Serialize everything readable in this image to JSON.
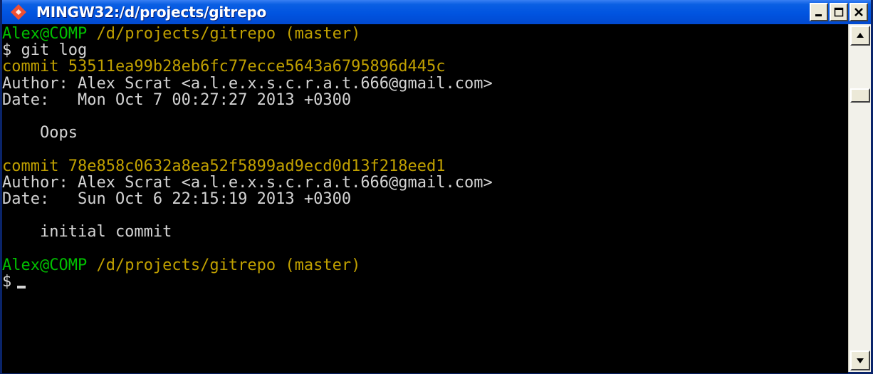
{
  "window": {
    "title": "MINGW32:/d/projects/gitrepo",
    "buttons": {
      "minimize": "minimize",
      "maximize": "maximize",
      "close": "close"
    }
  },
  "colors": {
    "prompt_user": "#00c000",
    "path": "#c0a000",
    "commit_hash": "#c0a000",
    "text": "#d4d4d4",
    "background": "#000000",
    "titlebar": "#0154e0"
  },
  "terminal": {
    "prompt1_user": "Alex@COMP",
    "prompt1_path": " /d/projects/gitrepo (master)",
    "command": "$ git log",
    "commit1": "commit 53511ea99b28eb6fc77ecce5643a6795896d445c",
    "author1": "Author: Alex Scrat <a.l.e.x.s.c.r.a.t.666@gmail.com>",
    "date1": "Date:   Mon Oct 7 00:27:27 2013 +0300",
    "message1": "    Oops",
    "commit2": "commit 78e858c0632a8ea52f5899ad9ecd0d13f218eed1",
    "author2": "Author: Alex Scrat <a.l.e.x.s.c.r.a.t.666@gmail.com>",
    "date2": "Date:   Sun Oct 6 22:15:19 2013 +0300",
    "message2": "    initial commit",
    "prompt2_user": "Alex@COMP",
    "prompt2_path": " /d/projects/gitrepo (master)",
    "final_prompt": "$"
  }
}
